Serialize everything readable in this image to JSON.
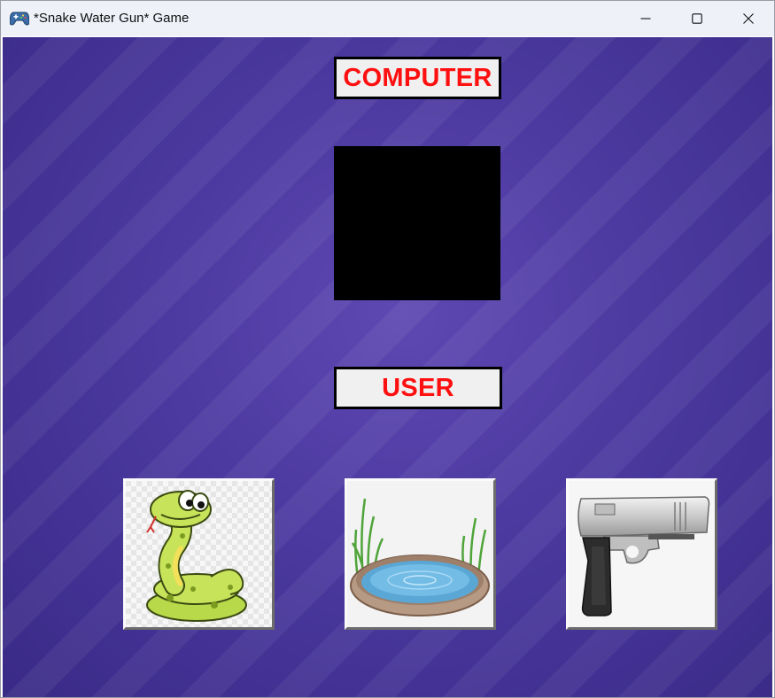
{
  "window": {
    "title": "*Snake Water Gun* Game",
    "icon": "gamepad-icon",
    "controls": [
      "minimize-icon",
      "maximize-icon",
      "close-icon"
    ]
  },
  "game": {
    "computer_label": "COMPUTER",
    "user_label": "USER",
    "choices": [
      {
        "name": "snake",
        "icon": "snake-icon"
      },
      {
        "name": "water",
        "icon": "pond-icon"
      },
      {
        "name": "gun",
        "icon": "pistol-icon"
      }
    ]
  },
  "colors": {
    "background": "#4b399f",
    "label_text": "#ff1010",
    "label_bg": "#f0f0f0",
    "display_bg": "#000000"
  }
}
